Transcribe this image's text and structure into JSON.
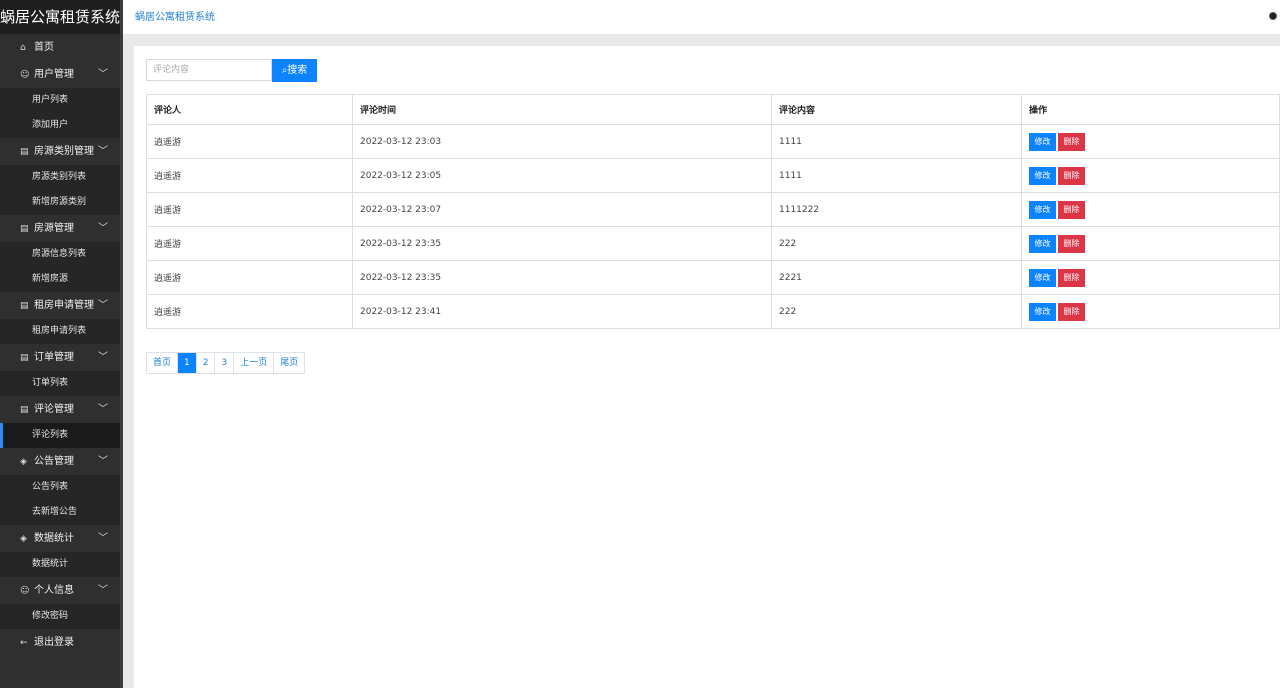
{
  "app": {
    "title": "蜗居公寓租赁系统",
    "breadcrumb": "蜗居公寓租赁系统"
  },
  "sidebar": {
    "home": {
      "icon": "home-icon",
      "label": "首页"
    },
    "groups": [
      {
        "icon": "user-icon",
        "label": "用户管理",
        "items": [
          "用户列表",
          "添加用户"
        ]
      },
      {
        "icon": "document-icon",
        "label": "房源类别管理",
        "items": [
          "房源类别列表",
          "新增房源类别"
        ]
      },
      {
        "icon": "document-icon",
        "label": "房源管理",
        "items": [
          "房源信息列表",
          "新增房源"
        ]
      },
      {
        "icon": "document-icon",
        "label": "租房申请管理",
        "items": [
          "租房申请列表"
        ]
      },
      {
        "icon": "document-icon",
        "label": "订单管理",
        "items": [
          "订单列表"
        ]
      },
      {
        "icon": "document-icon",
        "label": "评论管理",
        "items": [
          "评论列表"
        ]
      },
      {
        "icon": "layers-icon",
        "label": "公告管理",
        "items": [
          "公告列表",
          "去新增公告"
        ]
      },
      {
        "icon": "layers-icon",
        "label": "数据统计",
        "items": [
          "数据统计"
        ]
      },
      {
        "icon": "user-icon",
        "label": "个人信息",
        "items": [
          "修改密码"
        ]
      }
    ],
    "logout": {
      "icon": "arrow-left-icon",
      "label": "退出登录"
    },
    "active_item": "评论列表"
  },
  "search": {
    "placeholder": "评论内容",
    "value": "",
    "button_label": "搜索"
  },
  "table": {
    "columns": [
      "评论人",
      "评论时间",
      "评论内容",
      "操作"
    ],
    "rows": [
      {
        "commenter": "逍遥游",
        "time": "2022-03-12 23:03",
        "content": "1111"
      },
      {
        "commenter": "逍遥游",
        "time": "2022-03-12 23:05",
        "content": "1111"
      },
      {
        "commenter": "逍遥游",
        "time": "2022-03-12 23:07",
        "content": "1111222"
      },
      {
        "commenter": "逍遥游",
        "time": "2022-03-12 23:35",
        "content": "222"
      },
      {
        "commenter": "逍遥游",
        "time": "2022-03-12 23:35",
        "content": "2221"
      },
      {
        "commenter": "逍遥游",
        "time": "2022-03-12 23:41",
        "content": "222"
      }
    ],
    "edit_label": "修改",
    "delete_label": "删除"
  },
  "pagination": {
    "first": "首页",
    "pages": [
      "1",
      "2",
      "3"
    ],
    "current": "1",
    "prev": "上一页",
    "last": "尾页"
  },
  "colors": {
    "sidebar_bg": "#2f2f2f",
    "primary": "#0d84ff",
    "danger": "#dc3545",
    "link": "#1e7fd3"
  }
}
